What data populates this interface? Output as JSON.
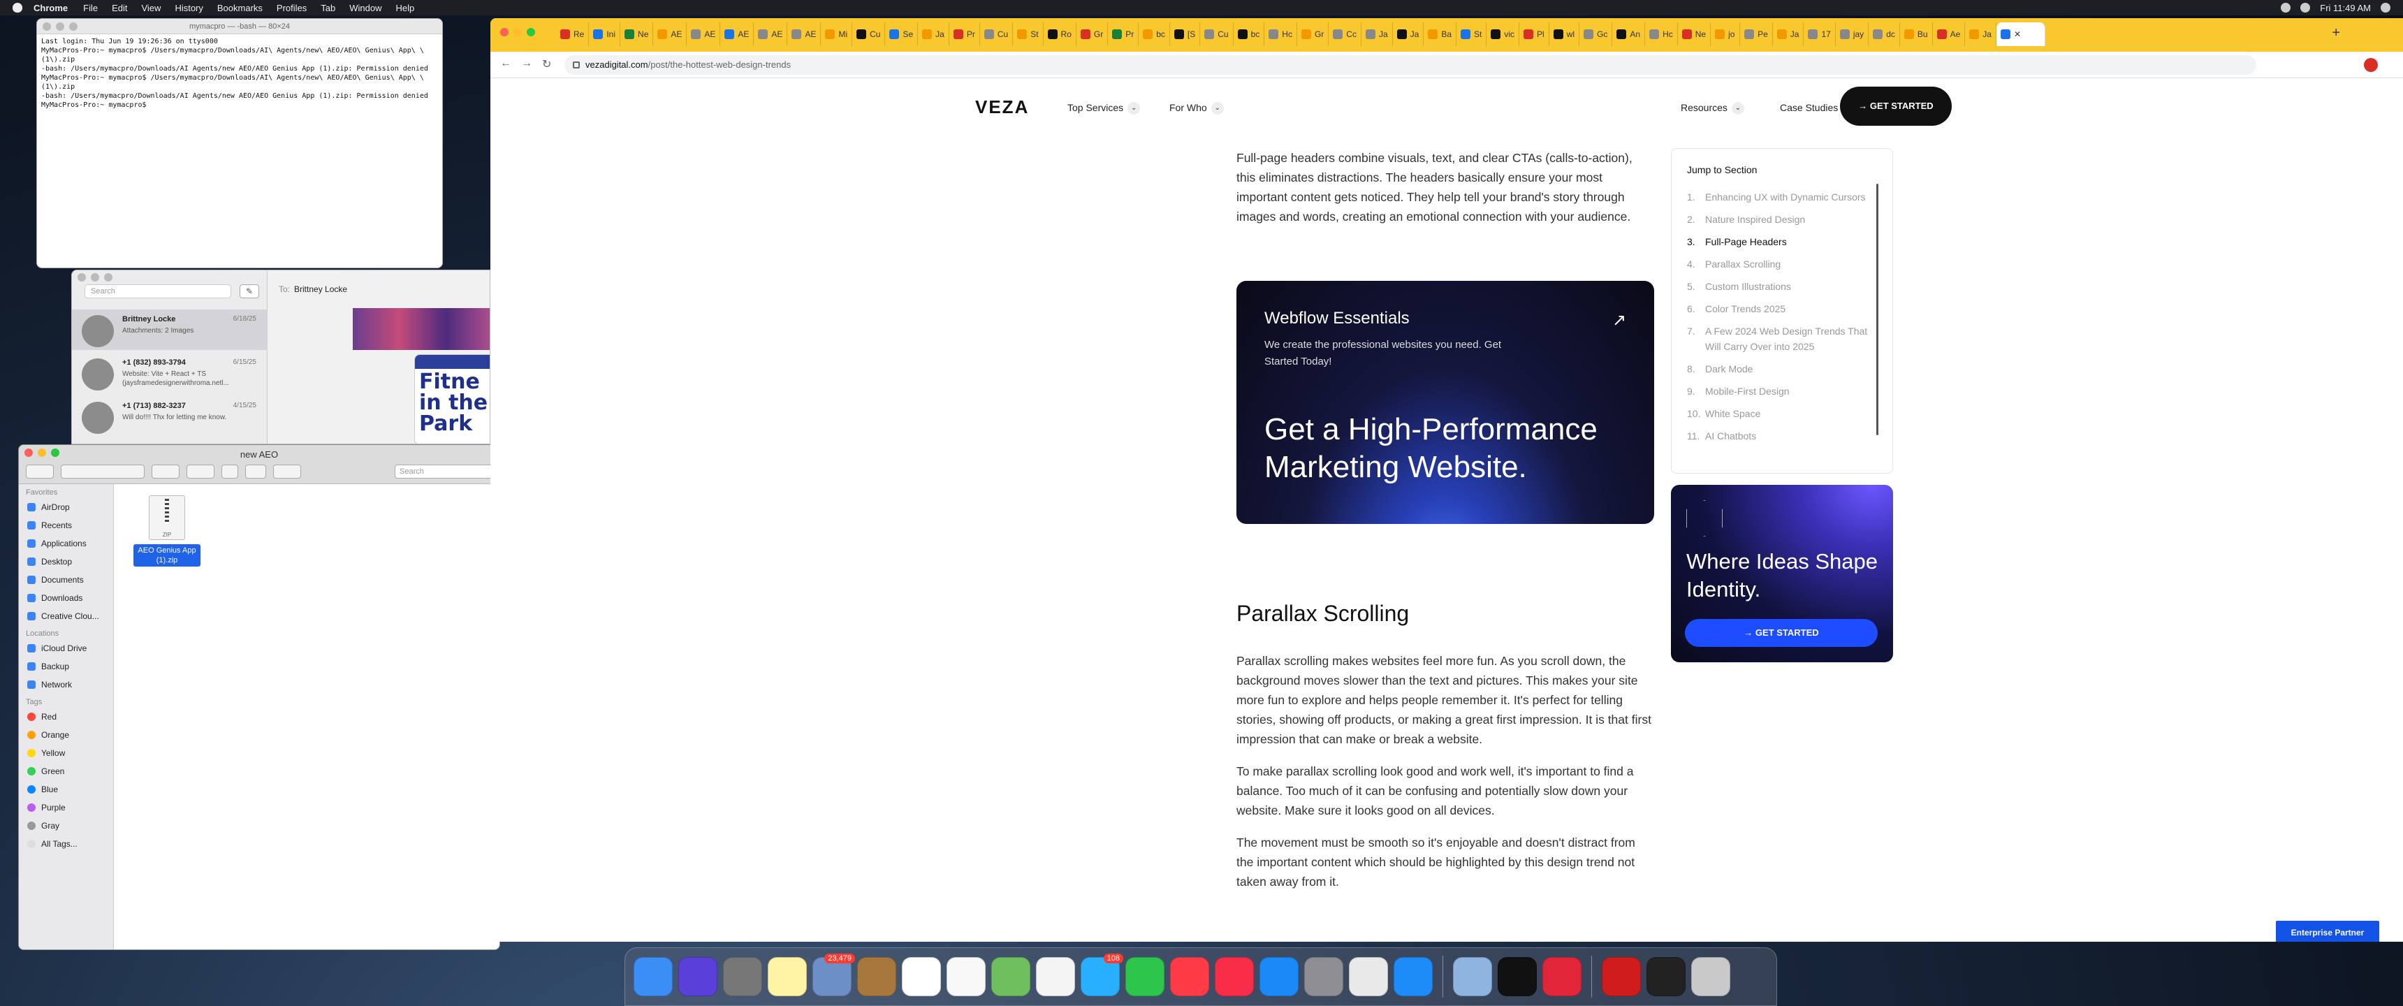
{
  "menubar": {
    "app": "Chrome",
    "items": [
      "File",
      "Edit",
      "View",
      "History",
      "Bookmarks",
      "Profiles",
      "Tab",
      "Window",
      "Help"
    ],
    "clock": "Fri 11:49 AM"
  },
  "terminal": {
    "title": "mymacpro — -bash — 80×24",
    "lines": "Last login: Thu Jun 19 19:26:36 on ttys000\nMyMacPros-Pro:~ mymacpro$ /Users/mymacpro/Downloads/AI\\ Agents/new\\ AEO/AEO\\ Genius\\ App\\ \\(1\\).zip\n-bash: /Users/mymacpro/Downloads/AI Agents/new AEO/AEO Genius App (1).zip: Permission denied\nMyMacPros-Pro:~ mymacpro$ /Users/mymacpro/Downloads/AI\\ Agents/new\\ AEO/AEO\\ Genius\\ App\\ \\(1\\).zip\n-bash: /Users/mymacpro/Downloads/AI Agents/new AEO/AEO Genius App (1).zip: Permission denied\nMyMacPros-Pro:~ mymacpro$ "
  },
  "messages": {
    "search": "Search",
    "to_label": "To:",
    "to_name": "Brittney Locke",
    "poster_text": "Fitne in the Park",
    "conversations": [
      {
        "name": "Brittney Locke",
        "date": "6/18/25",
        "preview": "Attachments: 2 Images"
      },
      {
        "name": "+1 (832) 893-3794",
        "date": "6/15/25",
        "preview": "Website: Vite + React + TS (jaysframedesignerwithroma.netl..."
      },
      {
        "name": "+1 (713) 882-3237",
        "date": "4/15/25",
        "preview": "Will do!!!! Thx for letting me know."
      }
    ]
  },
  "finder": {
    "title": "new AEO",
    "search": "Search",
    "favorites_header": "Favorites",
    "favorites": [
      "AirDrop",
      "Recents",
      "Applications",
      "Desktop",
      "Documents",
      "Downloads",
      "Creative Clou..."
    ],
    "locations_header": "Locations",
    "locations": [
      "iCloud Drive",
      "Backup",
      "Network"
    ],
    "tags_header": "Tags",
    "tags": [
      {
        "name": "Red",
        "color": "#ff453a"
      },
      {
        "name": "Orange",
        "color": "#ff9f0a"
      },
      {
        "name": "Yellow",
        "color": "#ffd60a"
      },
      {
        "name": "Green",
        "color": "#30d158"
      },
      {
        "name": "Blue",
        "color": "#0a84ff"
      },
      {
        "name": "Purple",
        "color": "#bf5af2"
      },
      {
        "name": "Gray",
        "color": "#98989d"
      },
      {
        "name": "All Tags...",
        "color": "#dddddd"
      }
    ],
    "file": {
      "name": "AEO Genius App (1).zip",
      "ext": "ZIP"
    }
  },
  "browser": {
    "tabs": [
      "Re",
      "Ini",
      "Ne",
      "AE",
      "AE",
      "AE",
      "AE",
      "AE",
      "Mi",
      "Cu",
      "Se",
      "Ja",
      "Pr",
      "Cu",
      "St",
      "Ro",
      "Gr",
      "Pr",
      "bc",
      "[S",
      "Cu",
      "bc",
      "Hc",
      "Gr",
      "Cc",
      "Ja",
      "Ja",
      "Ba",
      "St",
      "vic",
      "Pl",
      "wl",
      "Gc",
      "An",
      "Hc",
      "Ne",
      "jo",
      "Pe",
      "Ja",
      "17",
      "jay",
      "dc",
      "Bu",
      "Ae",
      "Ja"
    ],
    "tab_colors": [
      "#d93025",
      "#1a73e8",
      "#188038",
      "#f29900",
      "#888",
      "#1a73e8",
      "#888",
      "#888",
      "#f29900",
      "#111",
      "#1a73e8",
      "#f29900",
      "#d93025",
      "#888",
      "#f29900",
      "#111",
      "#d93025",
      "#188038",
      "#f29900",
      "#111",
      "#888",
      "#111",
      "#888",
      "#f29900",
      "#888",
      "#888",
      "#111",
      "#f29900",
      "#1a73e8",
      "#111",
      "#d93025",
      "#111",
      "#888",
      "#111",
      "#888",
      "#d93025",
      "#f29900",
      "#888",
      "#f29900",
      "#888",
      "#888",
      "#888",
      "#f29900",
      "#d93025",
      "#f29900"
    ],
    "active_tab": "",
    "url_host": "vezadigital.com",
    "url_path": "/post/the-hottest-web-design-trends"
  },
  "page": {
    "logo": "VEZA",
    "nav": [
      "Top Services",
      "For Who"
    ],
    "nav_right": [
      "Resources",
      "Case Studies"
    ],
    "cta": "GET STARTED",
    "intro": "Full-page headers combine visuals, text, and clear CTAs (calls-to-action), this eliminates distractions. The headers basically ensure your most important content gets noticed. They help tell your brand's story through images and words, creating an emotional connection with your audience.",
    "promo": {
      "title": "Webflow Essentials",
      "sub": "We create the professional websites you need. Get Started Today!",
      "headline": "Get a High-Performance Marketing Website."
    },
    "section_title": "Parallax Scrolling",
    "paragraphs": [
      "Parallax scrolling makes websites feel more fun. As you scroll down, the background moves slower than the text and pictures. This makes your site more fun to explore and helps people remember it. It's perfect for telling stories, showing off products, or making a great first impression. It is that first impression that can make or break a website.",
      "To make parallax scrolling look good and work well, it's important to find a balance. Too much of it can be confusing and potentially slow down your website. Make sure it looks good on all devices.",
      "The movement must be smooth so it's enjoyable and doesn't distract from the important content which should be highlighted by this design trend not taken away from it."
    ],
    "toc": {
      "title": "Jump to Section",
      "current": 3,
      "items": [
        "Enhancing UX with Dynamic Cursors",
        "Nature Inspired Design",
        "Full-Page Headers",
        "Parallax Scrolling",
        "Custom Illustrations",
        "Color Trends 2025",
        "A Few 2024 Web Design Trends That Will Carry Over into 2025",
        "Dark Mode",
        "Mobile-First Design",
        "White Space",
        "AI Chatbots"
      ]
    },
    "ad": {
      "title": "Where Ideas Shape Identity.",
      "button": "GET STARTED"
    },
    "badge": "Enterprise Partner"
  },
  "dock": {
    "apps": [
      {
        "name": "finder",
        "color": "#3a8ef6"
      },
      {
        "name": "siri",
        "color": "#5a3fd8"
      },
      {
        "name": "launchpad",
        "color": "#777"
      },
      {
        "name": "notes",
        "color": "#fff3a6"
      },
      {
        "name": "mail-stamps",
        "color": "#6d8fc8",
        "badge": "23,479"
      },
      {
        "name": "notebook",
        "color": "#a8773c"
      },
      {
        "name": "calendar",
        "color": "#ffffff"
      },
      {
        "name": "reminders",
        "color": "#f8f8f8"
      },
      {
        "name": "maps",
        "color": "#6fbf5f"
      },
      {
        "name": "photos",
        "color": "#f4f4f4"
      },
      {
        "name": "messages",
        "color": "#28b0ff",
        "badge": "108"
      },
      {
        "name": "facetime",
        "color": "#2ec54c"
      },
      {
        "name": "news",
        "color": "#ff3b47"
      },
      {
        "name": "music",
        "color": "#fa2d48"
      },
      {
        "name": "app-store",
        "color": "#1b8af8"
      },
      {
        "name": "system-settings",
        "color": "#8e8e93"
      },
      {
        "name": "chrome",
        "color": "#e9e9e9"
      },
      {
        "name": "safari",
        "color": "#1d8cf8"
      },
      {
        "name": "preview",
        "color": "#8fb4e0"
      },
      {
        "name": "terminal",
        "color": "#111"
      },
      {
        "name": "creative-cloud",
        "color": "#e2263a"
      },
      {
        "name": "acrobat",
        "color": "#d01c1c"
      },
      {
        "name": "downloads",
        "color": "#222"
      },
      {
        "name": "trash",
        "color": "#c9c9c9"
      }
    ]
  }
}
